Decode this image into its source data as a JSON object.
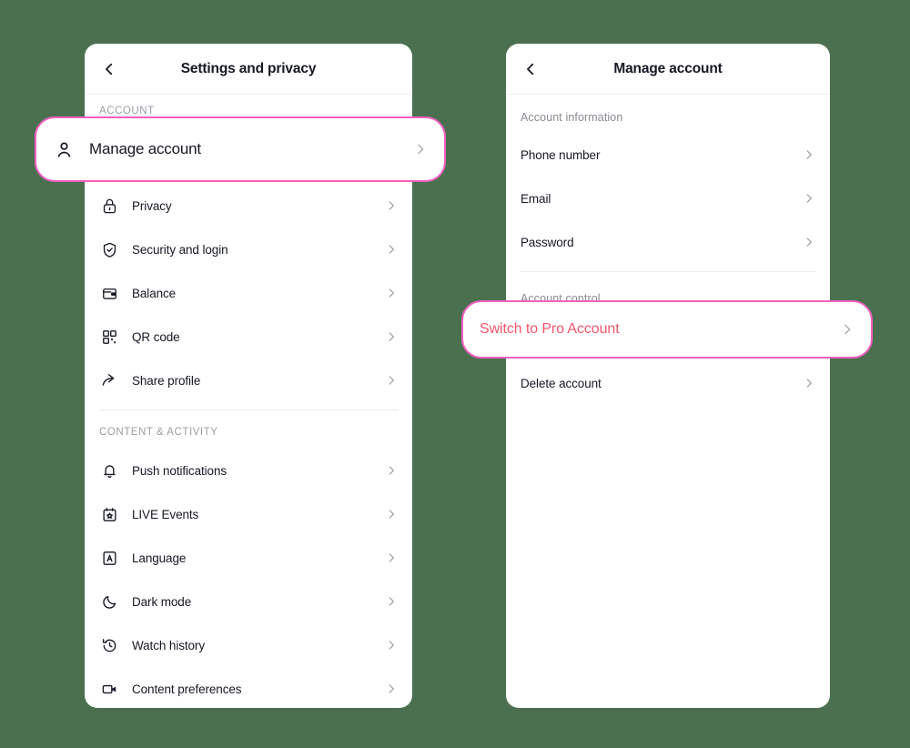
{
  "theme": {
    "background": "#4a7050",
    "panel_bg": "#ffffff",
    "text": "#161823",
    "muted": "#9b9da3",
    "highlight_border": "#f55fc1",
    "highlight_text": "#f4566c"
  },
  "left_panel": {
    "back_icon": "chevron-left-icon",
    "title": "Settings and privacy",
    "sections": [
      {
        "label": "ACCOUNT",
        "items": [
          {
            "icon": "lock-icon",
            "label": "Privacy"
          },
          {
            "icon": "shield-check-icon",
            "label": "Security and login"
          },
          {
            "icon": "wallet-icon",
            "label": "Balance"
          },
          {
            "icon": "qr-code-icon",
            "label": "QR code"
          },
          {
            "icon": "share-arrow-icon",
            "label": "Share profile"
          }
        ]
      },
      {
        "label": "CONTENT & ACTIVITY",
        "items": [
          {
            "icon": "bell-icon",
            "label": "Push notifications"
          },
          {
            "icon": "calendar-star-icon",
            "label": "LIVE Events"
          },
          {
            "icon": "language-a-icon",
            "label": "Language"
          },
          {
            "icon": "moon-icon",
            "label": "Dark mode"
          },
          {
            "icon": "clock-history-icon",
            "label": "Watch history"
          },
          {
            "icon": "video-camera-icon",
            "label": "Content preferences"
          }
        ]
      }
    ]
  },
  "right_panel": {
    "back_icon": "chevron-left-icon",
    "title": "Manage account",
    "sections": [
      {
        "label": "Account information",
        "items": [
          {
            "label": "Phone number"
          },
          {
            "label": "Email"
          },
          {
            "label": "Password"
          }
        ]
      },
      {
        "label": "Account control",
        "items": [
          {
            "label": "Switch to Pro Account"
          },
          {
            "label": "Delete account"
          }
        ]
      }
    ]
  },
  "callouts": {
    "manage_account": {
      "icon": "person-icon",
      "label": "Manage account",
      "chevron": "chevron-right-icon"
    },
    "switch_pro": {
      "label": "Switch to Pro Account",
      "chevron": "chevron-right-icon"
    }
  }
}
